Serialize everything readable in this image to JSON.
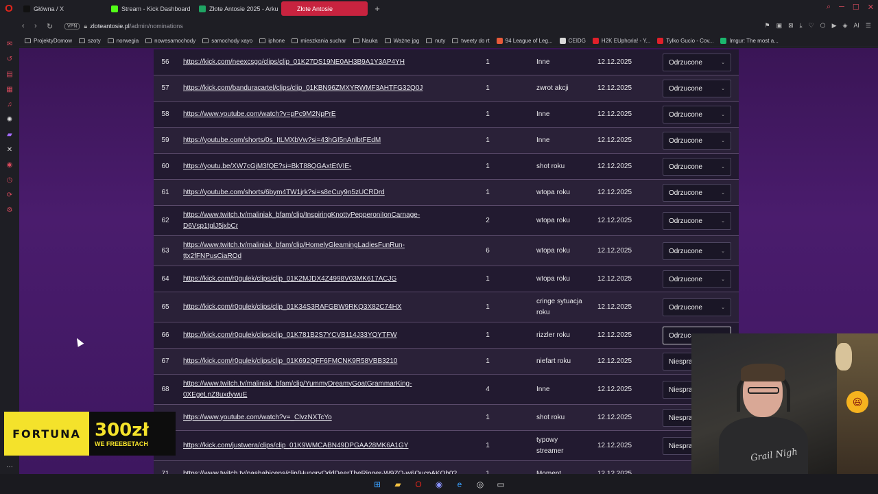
{
  "browser": {
    "tabs": [
      {
        "label": "Główna / X",
        "icon": "x-icon",
        "color": "#111111"
      },
      {
        "label": "Stream - Kick Dashboard",
        "icon": "kick-icon",
        "color": "#53fc18"
      },
      {
        "label": "Złote Antosie 2025 - Arku",
        "icon": "sheets-icon",
        "color": "#1fa463"
      },
      {
        "label": "Złote Antosie",
        "icon": "site-icon",
        "color": "#c8233f"
      }
    ],
    "active_tab": 3,
    "vpn_label": "VPN",
    "url_domain": "zloteantosie.pl",
    "url_path": "/admin/nominations"
  },
  "bookmarks": [
    {
      "label": "ProjektyDomow",
      "type": "folder"
    },
    {
      "label": "szoty",
      "type": "folder"
    },
    {
      "label": "norwegia",
      "type": "folder"
    },
    {
      "label": "nowesamochody",
      "type": "folder"
    },
    {
      "label": "samochody xayo",
      "type": "folder"
    },
    {
      "label": "iphone",
      "type": "folder"
    },
    {
      "label": "mieszkania suchar",
      "type": "folder"
    },
    {
      "label": "Nauka",
      "type": "folder"
    },
    {
      "label": "Ważne jpg",
      "type": "folder"
    },
    {
      "label": "nuty",
      "type": "folder"
    },
    {
      "label": "tweety do rt",
      "type": "folder"
    },
    {
      "label": "94 League of Leg...",
      "type": "site",
      "color": "#e85a3a"
    },
    {
      "label": "CEIDG",
      "type": "site",
      "color": "#d8d8d8"
    },
    {
      "label": "H2K EUphoria! - Y...",
      "type": "site",
      "color": "#e0202a"
    },
    {
      "label": "Tylko Gucio - Cov...",
      "type": "site",
      "color": "#e0202a"
    },
    {
      "label": "Imgur: The most a...",
      "type": "site",
      "color": "#1bb76e"
    }
  ],
  "table": {
    "rows": [
      {
        "id": "56",
        "link": "https://kick.com/neexcsgo/clips/clip_01K27DS19NE0AH3B9A1Y3AP4YH",
        "count": "1",
        "category": "Inne",
        "date": "12.12.2025",
        "status": "Odrzucone"
      },
      {
        "id": "57",
        "link": "https://kick.com/banduracartel/clips/clip_01KBN96ZMXYRWMF3AHTFG32Q0J",
        "count": "1",
        "category": "zwrot akcji",
        "date": "12.12.2025",
        "status": "Odrzucone"
      },
      {
        "id": "58",
        "link": "https://www.youtube.com/watch?v=pPc9M2NpPrE",
        "count": "1",
        "category": "Inne",
        "date": "12.12.2025",
        "status": "Odrzucone"
      },
      {
        "id": "59",
        "link": "https://youtube.com/shorts/0s_ItLMXbVw?si=43hGI5nAnlbtFEdM",
        "count": "1",
        "category": "Inne",
        "date": "12.12.2025",
        "status": "Odrzucone"
      },
      {
        "id": "60",
        "link": "https://youtu.be/XW7cGjM3fQE?si=BkT88QGAxtEtVIE-",
        "count": "1",
        "category": "shot roku",
        "date": "12.12.2025",
        "status": "Odrzucone"
      },
      {
        "id": "61",
        "link": "https://youtube.com/shorts/6bym4TW1jrk?si=s8eCuy9n5zUCRDrd",
        "count": "1",
        "category": "wtopa roku",
        "date": "12.12.2025",
        "status": "Odrzucone"
      },
      {
        "id": "62",
        "link": "https://www.twitch.tv/maliniak_bfam/clip/InspiringKnottyPepperoniIonCarnage-D6Vsp1tglJ5jxbCr",
        "count": "2",
        "category": "wtopa roku",
        "date": "12.12.2025",
        "status": "Odrzucone"
      },
      {
        "id": "63",
        "link": "https://www.twitch.tv/maliniak_bfam/clip/HomelyGleamingLadiesFunRun-ttx2fFNPusCiaROd",
        "count": "6",
        "category": "wtopa roku",
        "date": "12.12.2025",
        "status": "Odrzucone"
      },
      {
        "id": "64",
        "link": "https://kick.com/r0gulek/clips/clip_01K2MJDX4Z4998V03MK617ACJG",
        "count": "1",
        "category": "wtopa roku",
        "date": "12.12.2025",
        "status": "Odrzucone"
      },
      {
        "id": "65",
        "link": "https://kick.com/r0gulek/clips/clip_01K34S3RAFGBW9RKQ3X82C74HX",
        "count": "1",
        "category": "cringe sytuacja roku",
        "date": "12.12.2025",
        "status": "Odrzucone"
      },
      {
        "id": "66",
        "link": "https://kick.com/r0gulek/clips/clip_01K781B2S7YCVB114J33YQYTFW",
        "count": "1",
        "category": "rizzler roku",
        "date": "12.12.2025",
        "status": "Odrzucone"
      },
      {
        "id": "67",
        "link": "https://kick.com/r0gulek/clips/clip_01K692QFF6FMCNK9R58VBB3210",
        "count": "1",
        "category": "niefart roku",
        "date": "12.12.2025",
        "status": "Niespra"
      },
      {
        "id": "68",
        "link": "https://www.twitch.tv/maliniak_bfam/clip/YummyDreamyGoatGrammarKing-0XEgeLnZ8uxdywuE",
        "count": "4",
        "category": "Inne",
        "date": "12.12.2025",
        "status": "Niespra"
      },
      {
        "id": "",
        "link": "https://www.youtube.com/watch?v=_ClvzNXTcYo",
        "count": "1",
        "category": "shot roku",
        "date": "12.12.2025",
        "status": "Niespra"
      },
      {
        "id": "",
        "link": "https://kick.com/justwera/clips/clip_01K9WMCABN49DPGAA28MK6A1GY",
        "count": "1",
        "category": "typowy streamer",
        "date": "12.12.2025",
        "status": "Niespra"
      },
      {
        "id": "71",
        "link": "https://www.twitch.tv/pashabiceps/clip/HungryOddDeerTheRinger-W9ZO-w6OucpAKOh0?",
        "count": "1",
        "category": "Moment",
        "date": "12.12.2025",
        "status": ""
      }
    ]
  },
  "ad": {
    "brand": "FORTUNA",
    "amount": "300zł",
    "subtitle": "WE FREEBETACH"
  },
  "webcam": {
    "shirt_text": "Grail Nigh"
  }
}
